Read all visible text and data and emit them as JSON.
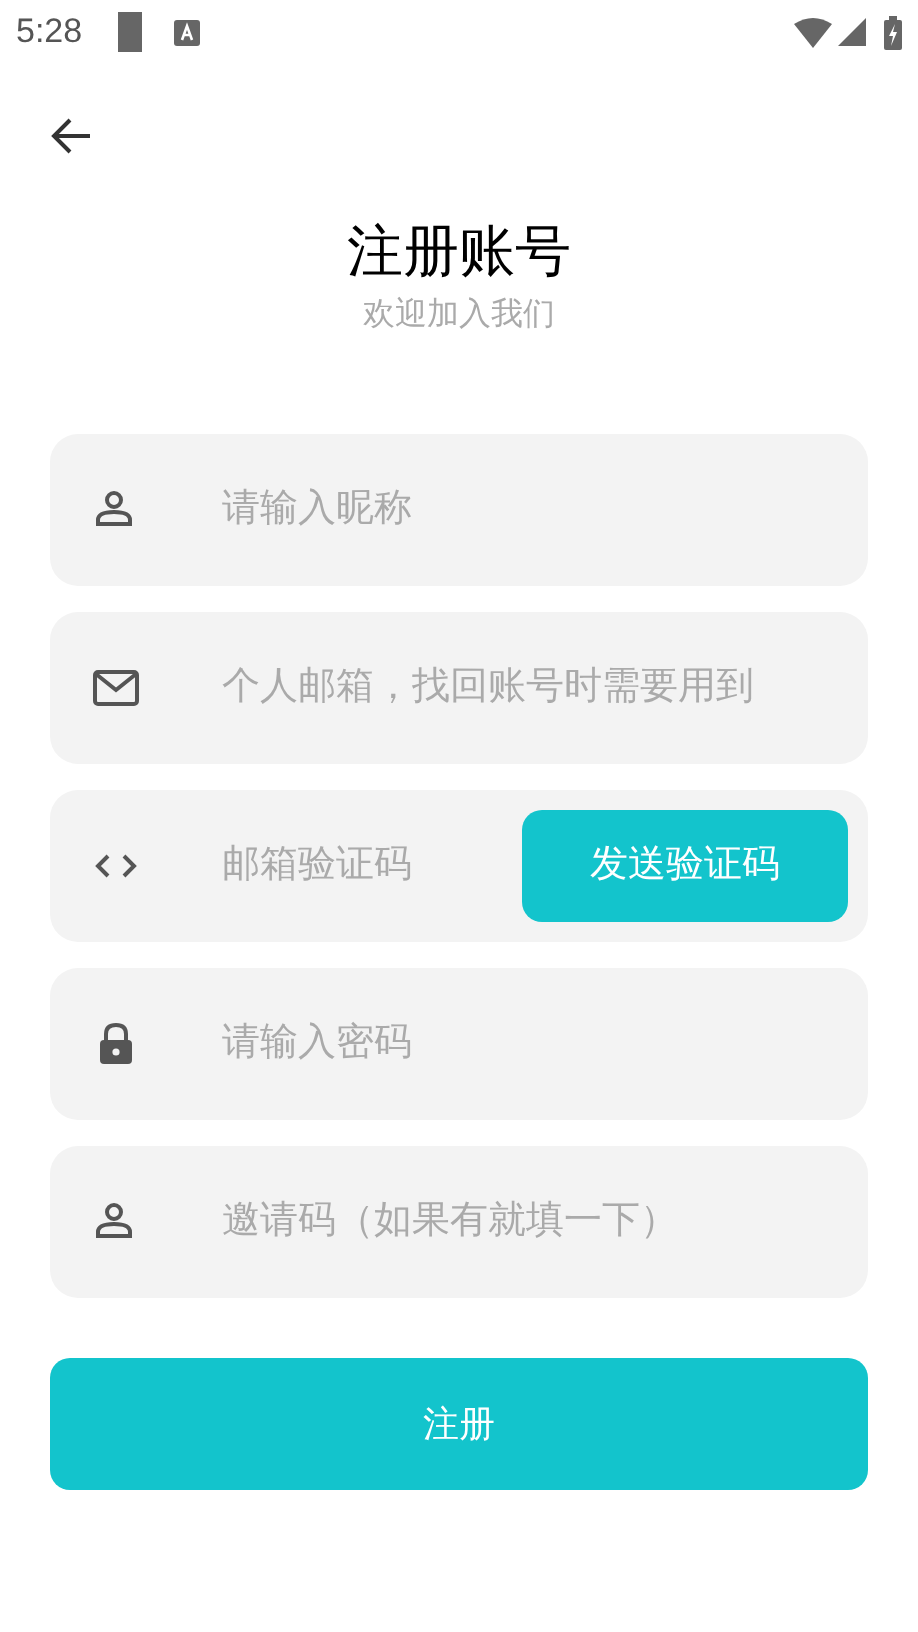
{
  "status_bar": {
    "time": "5:28"
  },
  "title": "注册账号",
  "subtitle": "欢迎加入我们",
  "fields": [
    {
      "kind": "user",
      "placeholder": "请输入昵称"
    },
    {
      "kind": "mail",
      "placeholder": "个人邮箱，找回账号时需要用到"
    },
    {
      "kind": "code",
      "placeholder": "邮箱验证码",
      "button": "发送验证码"
    },
    {
      "kind": "lock",
      "placeholder": "请输入密码"
    },
    {
      "kind": "user",
      "placeholder": "邀请码（如果有就填一下）"
    }
  ],
  "submit_button": "注册"
}
